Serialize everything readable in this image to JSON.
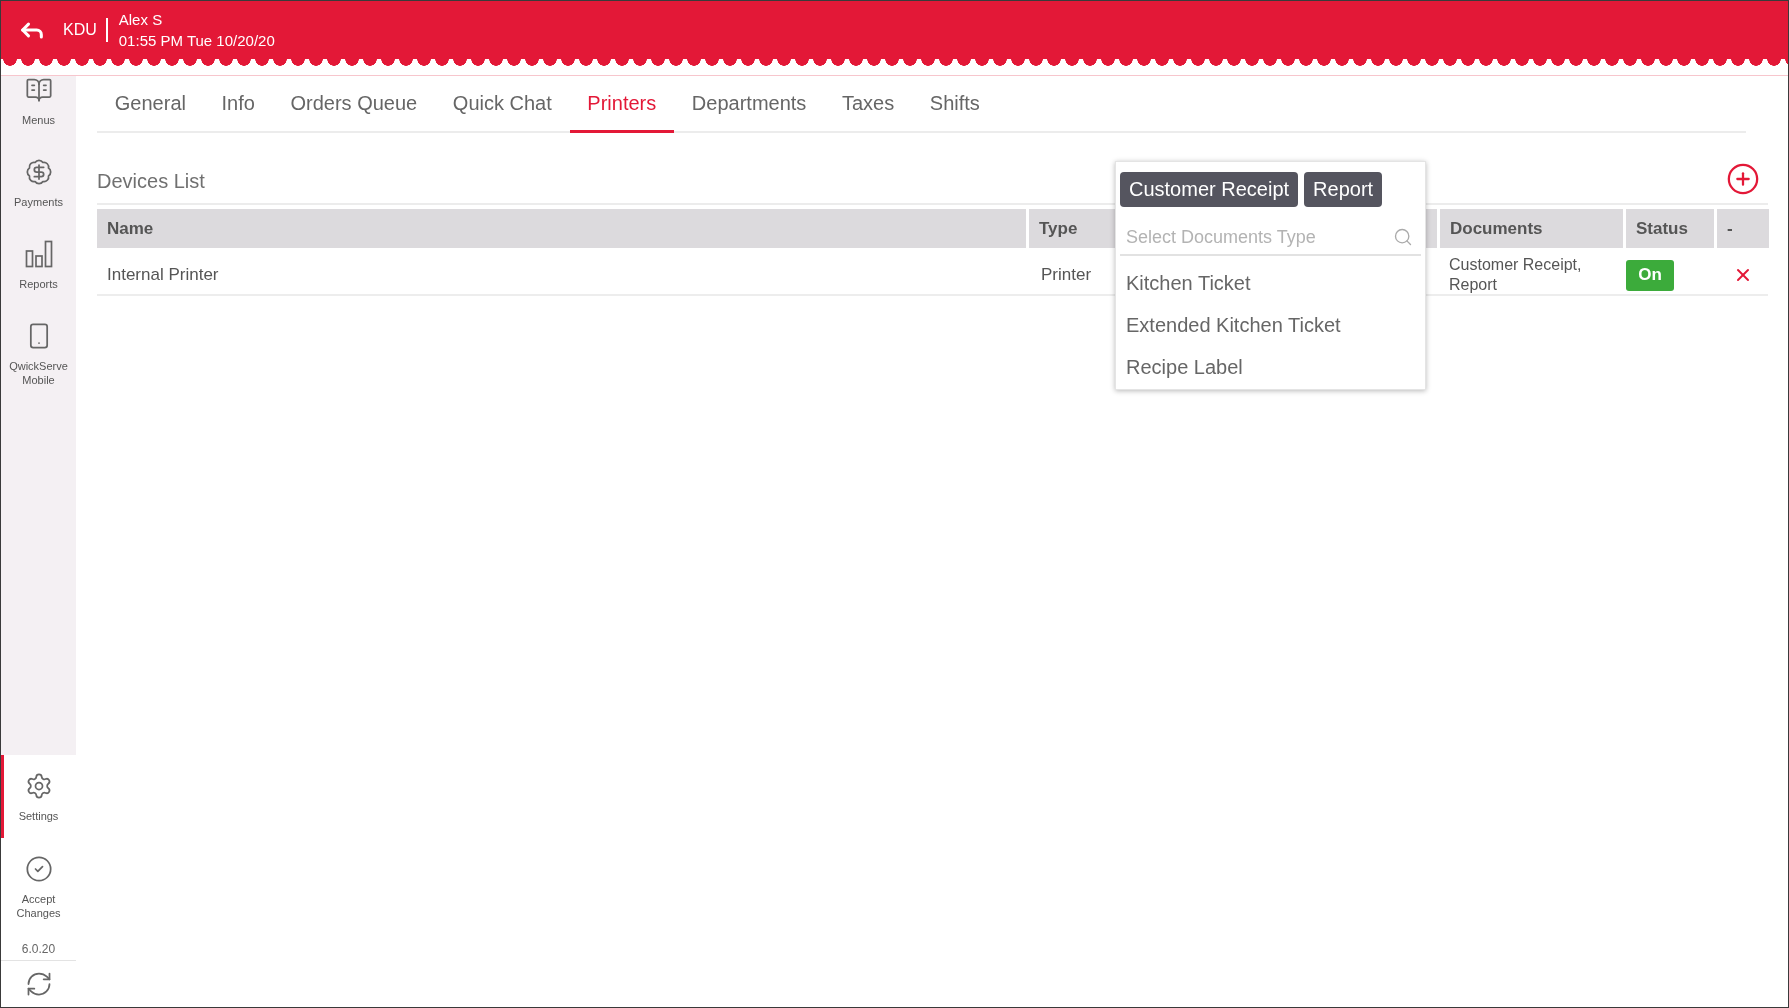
{
  "header": {
    "terminal": "KDU",
    "user": "Alex S",
    "datetime": "01:55 PM Tue 10/20/20"
  },
  "sidebar": {
    "items": [
      {
        "label": "Menus",
        "selected": false
      },
      {
        "label": "Payments",
        "selected": false
      },
      {
        "label": "Reports",
        "selected": false
      },
      {
        "label": "QwickServe Mobile",
        "selected": false
      }
    ],
    "bottom_items": [
      {
        "label": "Settings",
        "selected": true
      },
      {
        "label": "Accept Changes",
        "selected": false
      }
    ],
    "version": "6.0.20"
  },
  "tabs": [
    {
      "label": "General",
      "selected": false
    },
    {
      "label": "Info",
      "selected": false
    },
    {
      "label": "Orders Queue",
      "selected": false
    },
    {
      "label": "Quick Chat",
      "selected": false
    },
    {
      "label": "Printers",
      "selected": true
    },
    {
      "label": "Departments",
      "selected": false
    },
    {
      "label": "Taxes",
      "selected": false
    },
    {
      "label": "Shifts",
      "selected": false
    }
  ],
  "devices": {
    "title": "Devices List",
    "columns": [
      "Name",
      "Type",
      "Documents",
      "Status",
      "-"
    ],
    "rows": [
      {
        "name": "Internal Printer",
        "type": "Printer",
        "documents": "Customer Receipt, Report",
        "status": "On",
        "on": true
      }
    ]
  },
  "documents_dropdown": {
    "chips": [
      "Customer Receipt",
      "Report"
    ],
    "search": {
      "placeholder": "Select Documents Type"
    },
    "options": [
      "Kitchen Ticket",
      "Extended Kitchen Ticket",
      "Recipe Label"
    ]
  }
}
